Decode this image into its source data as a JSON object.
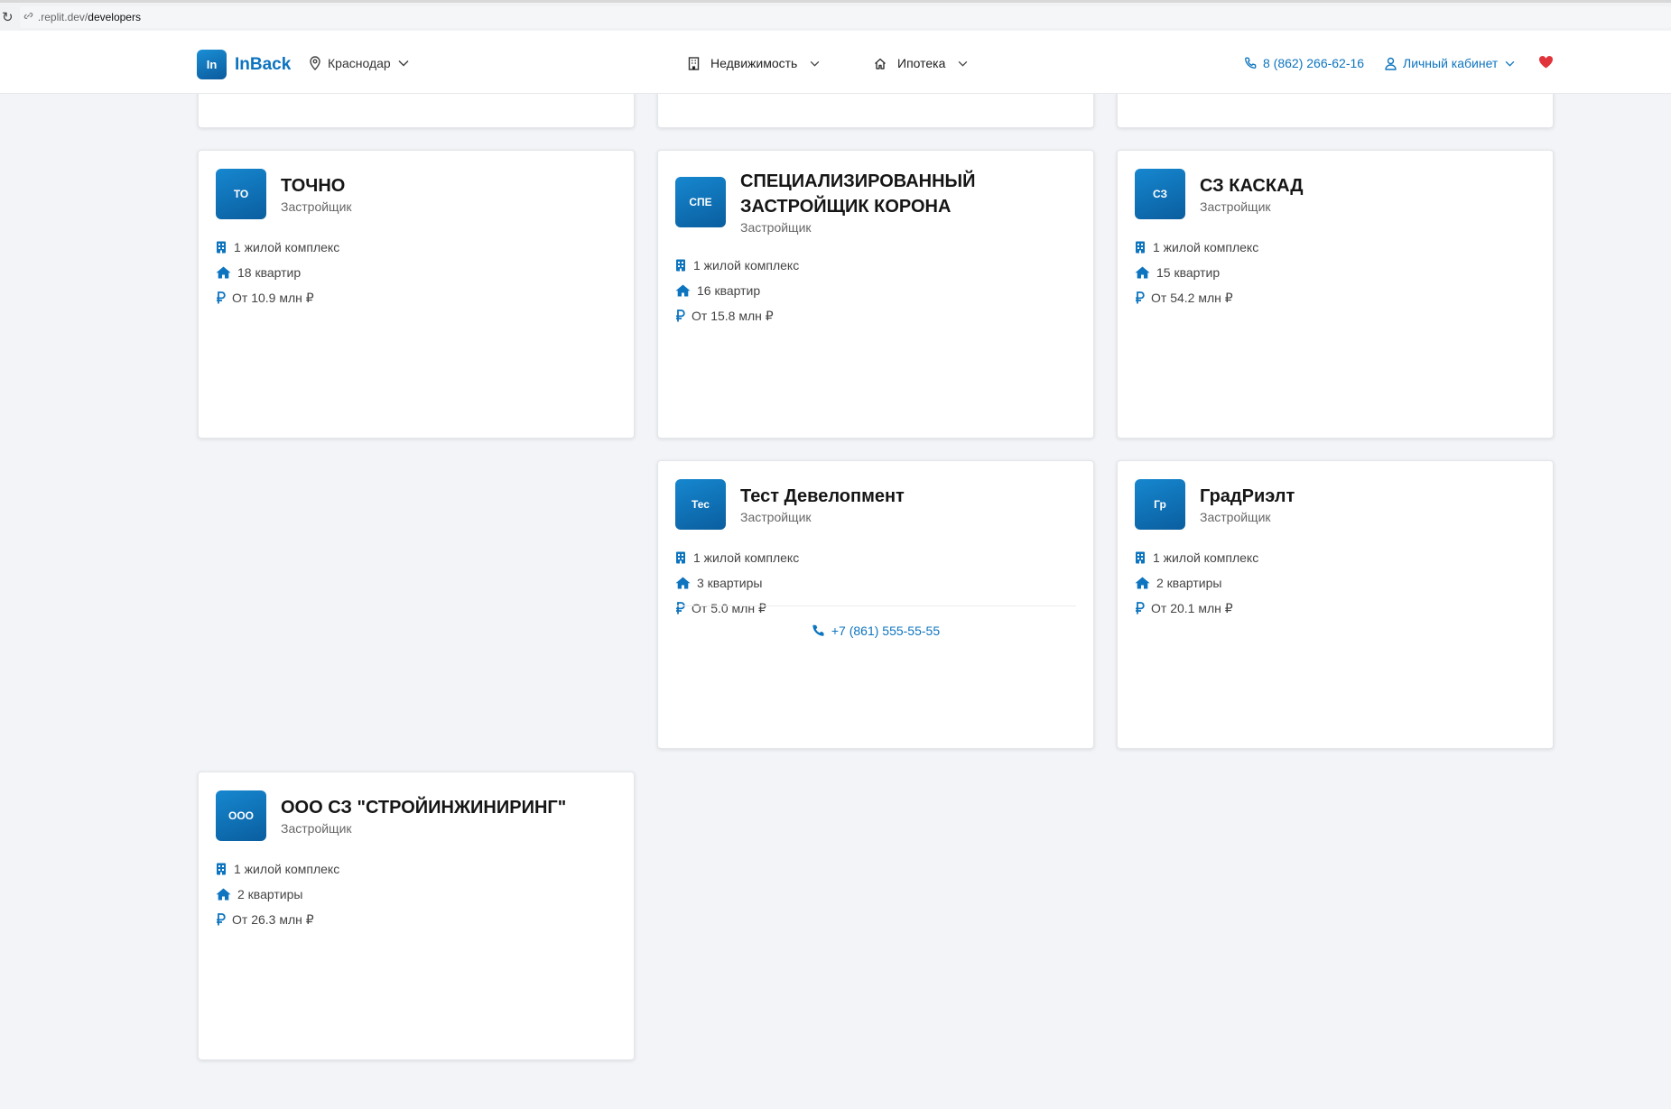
{
  "browser": {
    "url_prefix": ".replit.dev/",
    "url_path": "developers"
  },
  "header": {
    "logo_badge": "In",
    "logo_text": "InBack",
    "city": "Краснодар",
    "nav": [
      {
        "label": "Недвижимость",
        "icon": "building-icon"
      },
      {
        "label": "Ипотека",
        "icon": "house-icon"
      }
    ],
    "phone": "8 (862) 266-62-16",
    "cabinet": "Личный кабинет"
  },
  "colors": {
    "accent": "#0d74bf",
    "heart": "#e0343a",
    "background": "#f2f4f7"
  },
  "developers": [
    {
      "badge": "ТО",
      "name": "ТОЧНО",
      "type": "Застройщик",
      "complexes": "1 жилой комплекс",
      "flats": "18 квартир",
      "price": "От 10.9 млн ₽",
      "phone": ""
    },
    {
      "badge": "СПЕ",
      "name": "СПЕЦИАЛИЗИРОВАННЫЙ ЗАСТРОЙЩИК КОРОНА",
      "type": "Застройщик",
      "complexes": "1 жилой комплекс",
      "flats": "16 квартир",
      "price": "От 15.8 млн ₽",
      "phone": ""
    },
    {
      "badge": "СЗ",
      "name": "СЗ КАСКАД",
      "type": "Застройщик",
      "complexes": "1 жилой комплекс",
      "flats": "15 квартир",
      "price": "От 54.2 млн ₽",
      "phone": ""
    },
    {
      "badge": "Тес",
      "name": "Тест Девелопмент",
      "type": "Застройщик",
      "complexes": "1 жилой комплекс",
      "flats": "3 квартиры",
      "price": "От 5.0 млн ₽",
      "phone": "+7 (861) 555-55-55"
    },
    {
      "badge": "Гр",
      "name": "ГрадРиэлт",
      "type": "Застройщик",
      "complexes": "1 жилой комплекс",
      "flats": "2 квартиры",
      "price": "От 20.1 млн ₽",
      "phone": ""
    },
    {
      "badge": "ООО",
      "name": "ООО СЗ \"СТРОЙИНЖИНИРИНГ\"",
      "type": "Застройщик",
      "complexes": "1 жилой комплекс",
      "flats": "2 квартиры",
      "price": "От 26.3 млн ₽",
      "phone": ""
    }
  ]
}
